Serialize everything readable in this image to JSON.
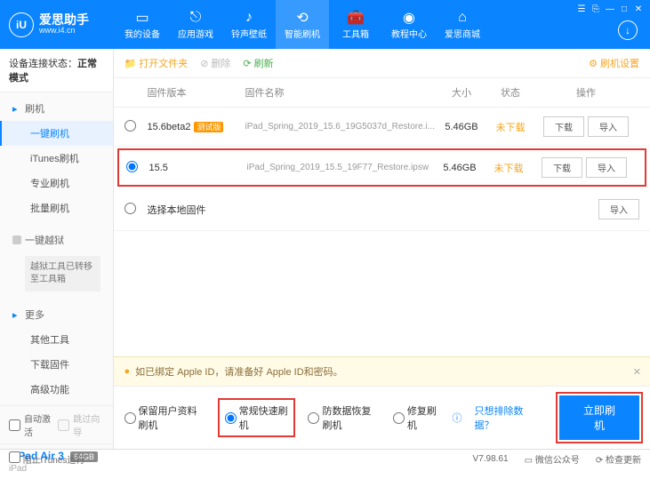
{
  "app": {
    "name": "爱思助手",
    "url": "www.i4.cn"
  },
  "nav": [
    {
      "label": "我的设备"
    },
    {
      "label": "应用游戏"
    },
    {
      "label": "铃声壁纸"
    },
    {
      "label": "智能刷机"
    },
    {
      "label": "工具箱"
    },
    {
      "label": "教程中心"
    },
    {
      "label": "爱思商城"
    }
  ],
  "conn": {
    "label": "设备连接状态：",
    "value": "正常模式"
  },
  "side": {
    "flash": {
      "title": "刷机",
      "items": [
        "一键刷机",
        "iTunes刷机",
        "专业刷机",
        "批量刷机"
      ]
    },
    "jail": {
      "title": "一键越狱",
      "note": "越狱工具已转移至工具箱"
    },
    "more": {
      "title": "更多",
      "items": [
        "其他工具",
        "下载固件",
        "高级功能"
      ]
    },
    "auto": "自动激活",
    "skip": "跳过向导"
  },
  "device": {
    "name": "iPad Air 3",
    "storage": "64GB",
    "type": "iPad"
  },
  "toolbar": {
    "open": "打开文件夹",
    "del": "删除",
    "refresh": "刷新",
    "settings": "刷机设置"
  },
  "th": {
    "ver": "固件版本",
    "name": "固件名称",
    "size": "大小",
    "status": "状态",
    "act": "操作"
  },
  "rows": [
    {
      "ver": "15.6beta2",
      "tag": "测试版",
      "name": "iPad_Spring_2019_15.6_19G5037d_Restore.i...",
      "size": "5.46GB",
      "status": "未下载"
    },
    {
      "ver": "15.5",
      "tag": "",
      "name": "iPad_Spring_2019_15.5_19F77_Restore.ipsw",
      "size": "5.46GB",
      "status": "未下载"
    }
  ],
  "local": "选择本地固件",
  "btn": {
    "download": "下载",
    "import": "导入"
  },
  "warn": "如已绑定 Apple ID，请准备好 Apple ID和密码。",
  "opts": {
    "keep": "保留用户资料刷机",
    "normal": "常规快速刷机",
    "recover": "防数据恢复刷机",
    "repair": "修复刷机",
    "exclude": "只想排除数据？",
    "go": "立即刷机"
  },
  "footer": {
    "block": "阻止iTunes运行",
    "ver": "V7.98.61",
    "wx": "微信公众号",
    "upd": "检查更新"
  }
}
